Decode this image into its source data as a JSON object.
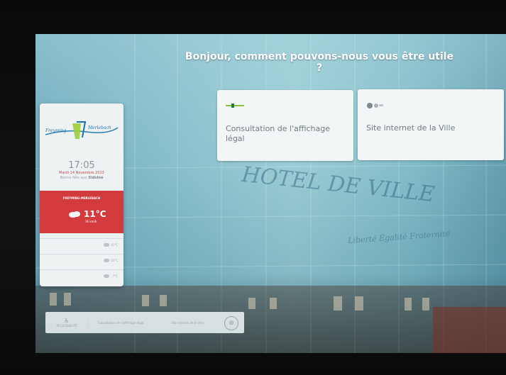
{
  "screen": {
    "heading": "Bonjour, comment pouvons-nous vous être utile ?"
  },
  "cards": [
    {
      "label": "Consultation de l'affichage légal",
      "icon": "notice-logo-icon"
    },
    {
      "label": "Site internet de la Ville",
      "icon": "website-logo-icon"
    }
  ],
  "widget": {
    "logo_text": "Freyming Merlebach",
    "time": "17:05",
    "date": "Mardi 14 Novembre 2023",
    "saint_prefix": "Bonne fête aux",
    "saint_name": "Sidoine",
    "weather": {
      "city": "FREYMING-MERLEBACH",
      "temperature": "11°C",
      "wind": "36 km/h",
      "icon": "cloud-icon"
    },
    "forecast": [
      {
        "temp": "11°C"
      },
      {
        "temp": "10°C"
      },
      {
        "temp": "7°C"
      }
    ]
  },
  "bottombar": {
    "accessibility": "ACCESSIBILITÉ",
    "item1": "Consultation de l'affichage légal",
    "item2": "Site internet de la Ville",
    "close": "⊗"
  },
  "background": {
    "building_text_1": "HOTEL DE VILLE",
    "building_text_2": "Liberté Égalité Fraternité"
  },
  "colors": {
    "accent_red": "#d23a3e",
    "card_bg": "#f3f6f6"
  }
}
